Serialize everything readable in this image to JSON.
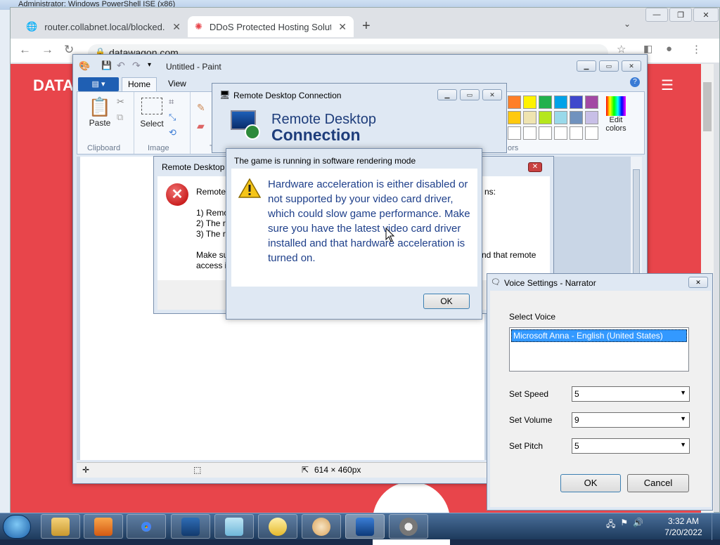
{
  "desktop": {
    "top_title": "Administrator: Windows PowerShell ISE (x86)"
  },
  "browser": {
    "tabs": [
      {
        "title": "router.collabnet.local/blocked.ph"
      },
      {
        "title": "DDoS Protected Hosting Solution"
      }
    ],
    "new_tab": "+",
    "url": "datawagon.com",
    "page_logo": "DATA"
  },
  "paint": {
    "title": "Untitled - Paint",
    "file_menu": "▾",
    "tabs": [
      "Home",
      "View"
    ],
    "groups": {
      "clipboard": "Clipboard",
      "image": "Image",
      "tools": "T",
      "colors": "ors"
    },
    "paste": "Paste",
    "select": "Select",
    "edit_colors_1": "Edit",
    "edit_colors_2": "colors",
    "status_size": "614 × 460px",
    "palette": [
      "#ff7f27",
      "#fff200",
      "#22b14c",
      "#00a2e8",
      "#3f48cc",
      "#a349a4",
      "#ffc90e",
      "#efe4b0",
      "#b5e61d",
      "#99d9ea",
      "#7092be",
      "#c8bfe7"
    ]
  },
  "rdc": {
    "title": "Remote Desktop Connection",
    "heading1": "Remote Desktop",
    "heading2": "Connection"
  },
  "rd_error": {
    "title": "Remote Desktop",
    "intro": "Remote",
    "intro_tail": "ns:",
    "l1": "1) Remo",
    "l2": "2) The re",
    "l3": "3) The re",
    "make_sure": "Make su",
    "make_sure_tail": "nd that remote",
    "access": "access is"
  },
  "game_dialog": {
    "title": "The game is running in software rendering mode",
    "message": "Hardware acceleration is either disabled or not supported by your video card driver, which could slow game performance. Make sure you have the latest video card driver installed and that hardware acceleration is turned on.",
    "ok": "OK"
  },
  "narrator": {
    "title": "Voice Settings - Narrator",
    "select_voice": "Select Voice",
    "voice_selected": "Microsoft Anna - English (United States)",
    "speed_label": "Set Speed",
    "speed": "5",
    "volume_label": "Set Volume",
    "volume": "9",
    "pitch_label": "Set Pitch",
    "pitch": "5",
    "ok": "OK",
    "cancel": "Cancel"
  },
  "taskbar": {
    "time": "3:32 AM",
    "date": "7/20/2022",
    "icons": [
      "explorer-icon",
      "media-player-icon",
      "chrome-icon",
      "powershell-icon",
      "notepad-icon",
      "messenger-icon",
      "paint-icon",
      "remote-desktop-icon",
      "settings-icon"
    ]
  }
}
